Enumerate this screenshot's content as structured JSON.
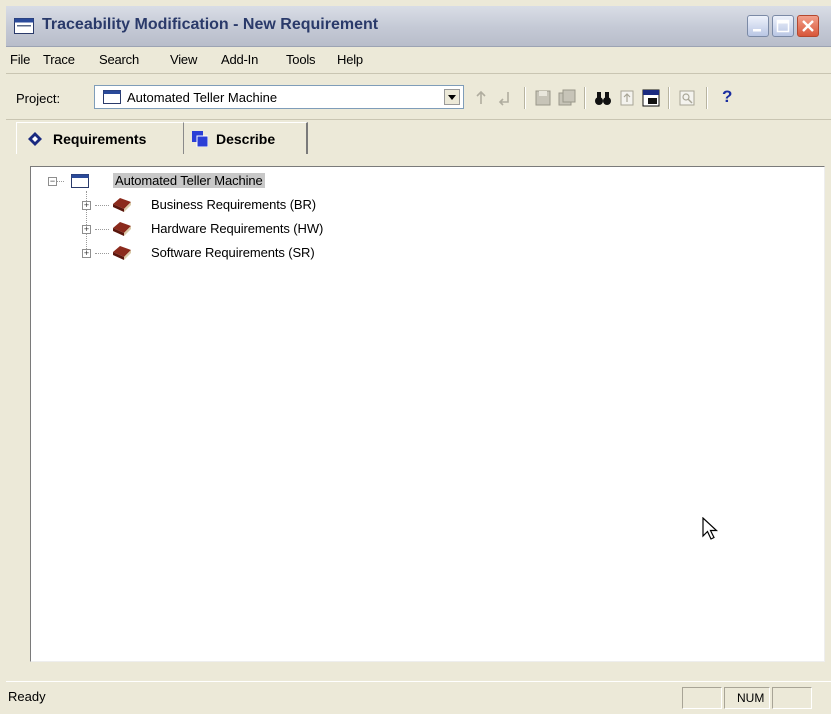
{
  "window": {
    "title": "Traceability Modification - New Requirement"
  },
  "menu": [
    "File",
    "Trace",
    "Search",
    "View",
    "Add-In",
    "Tools",
    "Help"
  ],
  "toolbar": {
    "project_label": "Project:",
    "project_value": "Automated Teller Machine",
    "buttons": [
      "up-arrow-icon",
      "down-arrow-icon",
      "save-icon",
      "save-all-icon",
      "binoculars-icon",
      "sort-icon",
      "window-icon",
      "find-icon",
      "help-icon"
    ],
    "help_glyph": "?"
  },
  "tabs": [
    {
      "label": "Requirements",
      "icon": "diamond-icon",
      "active": true
    },
    {
      "label": "Describe",
      "icon": "describe-icon",
      "active": false
    }
  ],
  "tree": {
    "root": {
      "label": "Automated Teller Machine",
      "expanded": true,
      "expander": "−"
    },
    "children": [
      {
        "label": "Business Requirements (BR)",
        "expander": "+",
        "icon": "book-icon"
      },
      {
        "label": "Hardware Requirements (HW)",
        "expander": "+",
        "icon": "book-icon"
      },
      {
        "label": "Software Requirements (SR)",
        "expander": "+",
        "icon": "book-icon"
      }
    ]
  },
  "status": {
    "text": "Ready",
    "num": "NUM"
  },
  "colors": {
    "face": "#ece9d8",
    "title_text": "#2a3a6a",
    "book": "#8b2a1c",
    "help": "#1b2ea0",
    "close": "#d8563a"
  }
}
